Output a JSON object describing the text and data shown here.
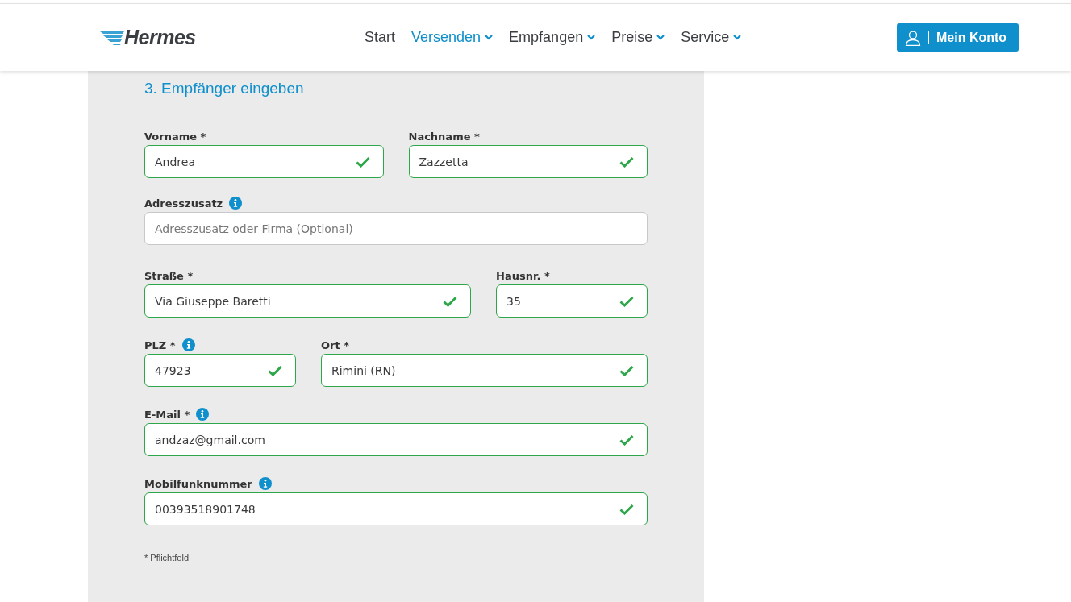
{
  "header": {
    "logo": "Hermes",
    "nav": [
      {
        "label": "Start",
        "selected": false,
        "dropdown": false
      },
      {
        "label": "Versenden",
        "selected": true,
        "dropdown": true
      },
      {
        "label": "Empfangen",
        "selected": false,
        "dropdown": true
      },
      {
        "label": "Preise",
        "selected": false,
        "dropdown": true
      },
      {
        "label": "Service",
        "selected": false,
        "dropdown": true
      }
    ],
    "account_button": "Mein Konto"
  },
  "form": {
    "title": "3. Empfänger eingeben",
    "rows": [
      [
        {
          "label": "Vorname *",
          "info": false,
          "value": "Andrea",
          "valid": true
        },
        {
          "label": "Nachname *",
          "info": false,
          "value": "Zazzetta",
          "valid": true
        }
      ],
      [
        {
          "label": "Adresszusatz",
          "info": true,
          "placeholder": "Adresszusatz oder Firma (Optional)",
          "valid": false
        }
      ],
      [
        {
          "label": "Straße *",
          "info": false,
          "value": "Via Giuseppe Baretti",
          "valid": true
        },
        {
          "label": "Hausnr. *",
          "info": false,
          "value": "35",
          "valid": true
        }
      ],
      [
        {
          "label": "PLZ *",
          "info": true,
          "value": "47923",
          "valid": true
        },
        {
          "label": "Ort *",
          "info": false,
          "value": "Rimini (RN)",
          "valid": true
        }
      ],
      [
        {
          "label": "E-Mail *",
          "info": true,
          "value": "andzaz@gmail.com",
          "valid": true
        }
      ],
      [
        {
          "label": "Mobilfunknummer",
          "info": true,
          "value": "00393518901748",
          "valid": true
        }
      ]
    ],
    "footnote": "* Pflichtfeld"
  }
}
